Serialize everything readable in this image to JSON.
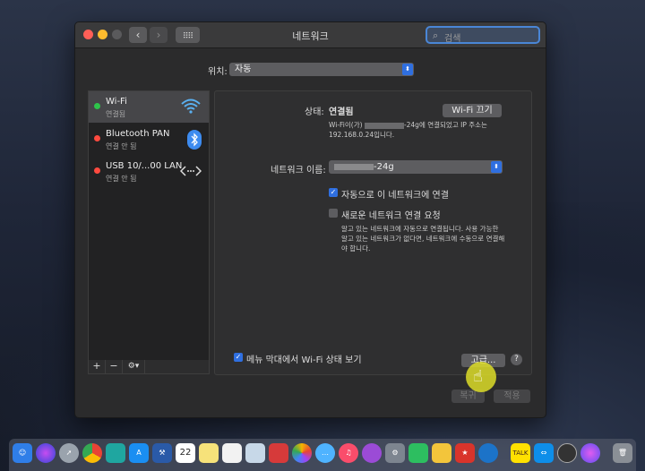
{
  "window": {
    "title": "네트워크"
  },
  "search": {
    "placeholder": "검색"
  },
  "location": {
    "label": "위치:",
    "value": "자동"
  },
  "services": [
    {
      "name": "Wi-Fi",
      "status": "연결됨",
      "color": "#2ec44a",
      "icon": "wifi-icon"
    },
    {
      "name": "Bluetooth PAN",
      "status": "연결 안 됨",
      "color": "#ff4a3f",
      "icon": "bluetooth-icon"
    },
    {
      "name": "USB 10/...00 LAN",
      "status": "연결 안 됨",
      "color": "#ff4a3f",
      "icon": "ethernet-icon"
    }
  ],
  "list_tools": {
    "add": "+",
    "remove": "−",
    "gear": "⚙▾"
  },
  "detail": {
    "status_label": "상태:",
    "status_value": "연결됨",
    "wifi_off_button": "Wi-Fi 끄기",
    "status_desc_a": "Wi-Fi이(가)",
    "status_desc_b": "-24g에 연결되었고 IP 주소는",
    "status_desc_c": "192.168.0.24입니다.",
    "network_name_label": "네트워크 이름:",
    "network_name_value": "-24g",
    "auto_join_label": "자동으로 이 네트워크에 연결",
    "auto_join_checked": true,
    "ask_join_label": "새로운 네트워크 연결 요청",
    "ask_join_checked": false,
    "ask_join_desc_1": "알고 있는 네트워크에 자동으로 연결됩니다. 사용 가능한",
    "ask_join_desc_2": "알고 있는 네트워크가 없다면, 네트워크에 수동으로 연결해",
    "ask_join_desc_3": "야 합니다.",
    "menubar_label": "메뉴 막대에서 Wi-Fi 상태 보기",
    "menubar_checked": true,
    "advanced_button": "고급...",
    "help": "?"
  },
  "footer": {
    "revert_button": "복귀",
    "apply_button": "적용"
  },
  "dock": {
    "icons": [
      "finder-icon",
      "siri-icon",
      "launchpad-icon",
      "chrome-icon",
      "app-icon",
      "appstore-icon",
      "xcode-icon",
      "calendar-icon",
      "notes-icon",
      "reminders-icon",
      "preview-icon",
      "photobooth-icon",
      "photos-icon",
      "messages-icon",
      "music-icon",
      "podcast-icon",
      "system-preferences-icon",
      "evernote-icon",
      "finder2-icon",
      "star-icon",
      "vpn-icon",
      "kakaotalk-icon",
      "teamviewer-icon",
      "quicktime-icon",
      "siri2-icon",
      "trash-icon"
    ],
    "calendar_day": "22",
    "kakao_label": "TALK"
  }
}
